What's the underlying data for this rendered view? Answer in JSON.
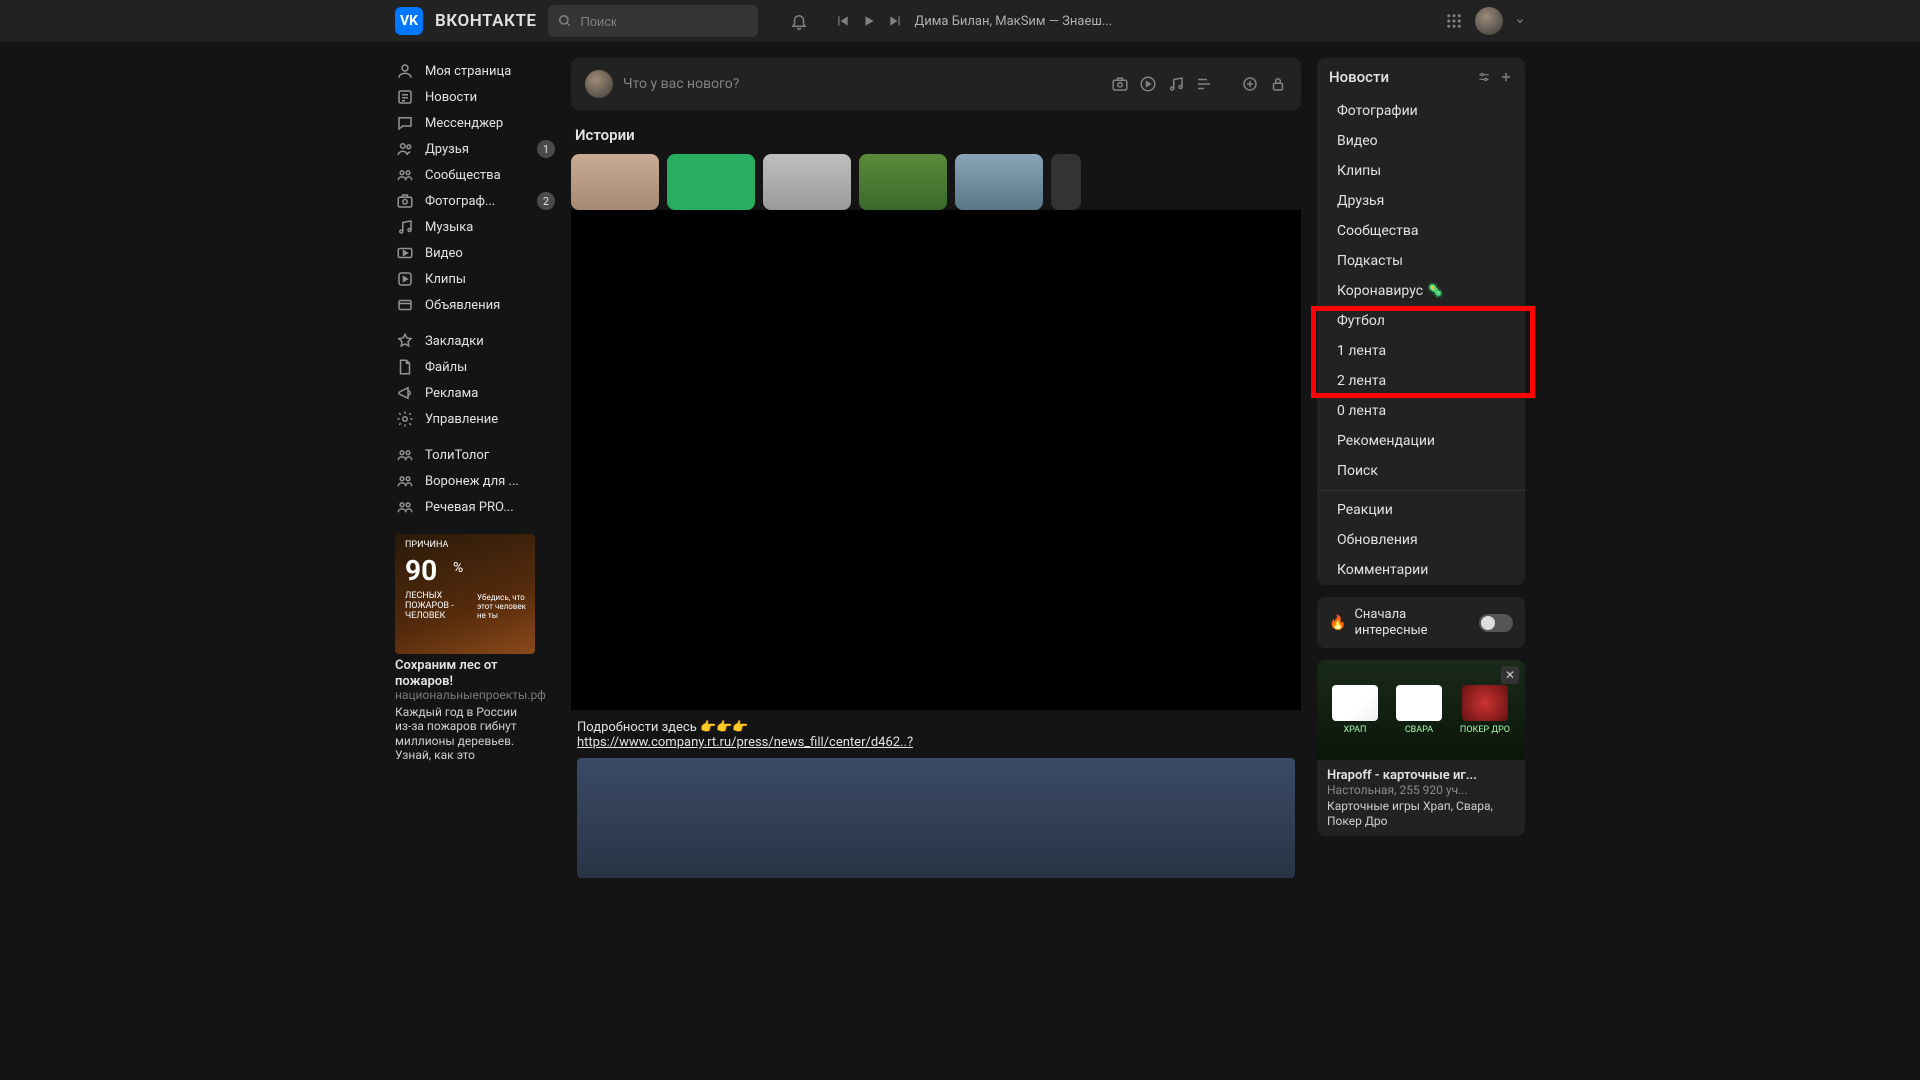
{
  "header": {
    "brand": "ВКОНТАКТЕ",
    "search_placeholder": "Поиск",
    "now_playing": "Дима Билан, МакSим — Знаеш..."
  },
  "nav": [
    {
      "icon": "user",
      "label": "Моя страница",
      "badge": null
    },
    {
      "icon": "news",
      "label": "Новости",
      "badge": null
    },
    {
      "icon": "chat",
      "label": "Мессенджер",
      "badge": null
    },
    {
      "icon": "friends",
      "label": "Друзья",
      "badge": "1"
    },
    {
      "icon": "group",
      "label": "Сообщества",
      "badge": null
    },
    {
      "icon": "photo",
      "label": "Фотограф...",
      "badge": "2"
    },
    {
      "icon": "music",
      "label": "Музыка",
      "badge": null
    },
    {
      "icon": "video",
      "label": "Видео",
      "badge": null
    },
    {
      "icon": "clips",
      "label": "Клипы",
      "badge": null
    },
    {
      "icon": "ads",
      "label": "Объявления",
      "badge": null
    }
  ],
  "nav2": [
    {
      "icon": "bookmark",
      "label": "Закладки"
    },
    {
      "icon": "file",
      "label": "Файлы"
    },
    {
      "icon": "mega",
      "label": "Реклама"
    },
    {
      "icon": "gear",
      "label": "Управление"
    }
  ],
  "nav3": [
    {
      "icon": "group",
      "label": "ТолиТолог"
    },
    {
      "icon": "group",
      "label": "Воронеж для ..."
    },
    {
      "icon": "group",
      "label": "Речевая PRO..."
    }
  ],
  "promo": {
    "top_small": "ПРИЧИНА",
    "big": "90",
    "pct": "%",
    "mid_small": "ЛЕСНЫХ ПОЖАРОВ - ЧЕЛОВЕК",
    "right_small": "Убедись, что этот человек не ты",
    "title": "Сохраним лес от пожаров!",
    "sub": "национальныепроекты.рф",
    "desc": "Каждый год в России из-за пожаров гибнут миллионы деревьев. Узнай, как это"
  },
  "compose": {
    "placeholder": "Что у вас нового?"
  },
  "stories": {
    "title": "Истории"
  },
  "post_after": {
    "line": "Подробности здесь 👉👉👉",
    "link": "https://www.company.rt.ru/press/news_fill/center/d462..?"
  },
  "right": {
    "head": "Новости",
    "items": [
      "Фотографии",
      "Видео",
      "Клипы",
      "Друзья",
      "Сообщества",
      "Подкасты",
      "Коронавирус 🦠",
      "Футбол",
      "1 лента",
      "2 лента",
      "0 лента",
      "Рекомендации",
      "Поиск"
    ],
    "items2": [
      "Реакции",
      "Обновления",
      "Комментарии"
    ]
  },
  "toggle": {
    "label": "Сначала интересные"
  },
  "ad": {
    "tiles": [
      "ХРАП",
      "СВАРА",
      "ПОКЕР ДРО"
    ],
    "title": "Hrapoff - карточные иг...",
    "sub": "Настольная, 255 920 уч...",
    "desc": "Карточные игры Храп, Свара, Покер Дро"
  }
}
